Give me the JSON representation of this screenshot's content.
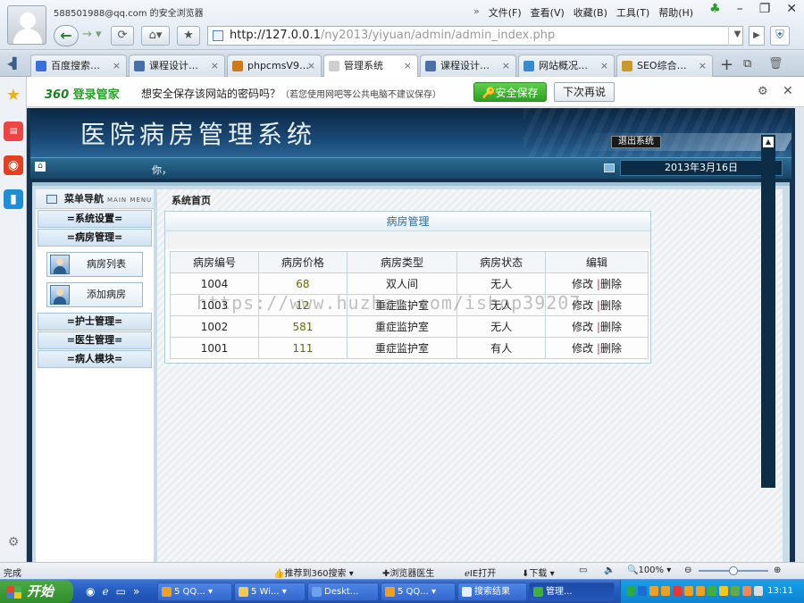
{
  "browser": {
    "account": "588501988@qq.com 的安全浏览器",
    "menu": [
      "文件(F)",
      "查看(V)",
      "收藏(B)",
      "工具(T)",
      "帮助(H)"
    ],
    "url_host": "http://127.0.0.1",
    "url_path": "/ny2013/yiyuan/admin/admin_index.php",
    "tabs": [
      {
        "label": "百度搜索…",
        "color": "#3a6ee0"
      },
      {
        "label": "课程设计…",
        "color": "#4a6fa8"
      },
      {
        "label": "phpcmsV9…",
        "color": "#cc7a1a"
      },
      {
        "label": "管理系统",
        "color": "#cfcfcf"
      },
      {
        "label": "课程设计…",
        "color": "#4a6fa8"
      },
      {
        "label": "网站概况…",
        "color": "#3a8ad0"
      },
      {
        "label": "SEO综合…",
        "color": "#c99a2a"
      }
    ]
  },
  "password_bar": {
    "logo_brand": "360",
    "logo_text": "登录管家",
    "message": "想安全保存该网站的密码吗？",
    "hint": "（若您使用网吧等公共电脑不建议保存）",
    "save_label": "安全保存",
    "later_label": "下次再说"
  },
  "app": {
    "title": "医院病房管理系统",
    "logout_label": "退出系统",
    "greeting": "你，",
    "date": "2013年3月16日",
    "watermark": "https://www.huzhan.com/ishop39207"
  },
  "sidebar": {
    "title": "菜单导航",
    "title_en": "MAIN MENU",
    "groups": [
      {
        "label": "=系统设置="
      },
      {
        "label": "=病房管理="
      },
      {
        "label": "=护士管理="
      },
      {
        "label": "=医生管理="
      },
      {
        "label": "=病人模块="
      }
    ],
    "items": [
      {
        "label": "病房列表"
      },
      {
        "label": "添加病房"
      }
    ]
  },
  "main": {
    "breadcrumb": "系统首页",
    "panel_title": "病房管理",
    "columns": [
      "病房编号",
      "病房价格",
      "病房类型",
      "病房状态",
      "编辑"
    ],
    "rows": [
      {
        "id": "1004",
        "price": "68",
        "type": "双人间",
        "status": "无人"
      },
      {
        "id": "1003",
        "price": "12",
        "type": "重症监护室",
        "status": "无人"
      },
      {
        "id": "1002",
        "price": "581",
        "type": "重症监护室",
        "status": "无人"
      },
      {
        "id": "1001",
        "price": "111",
        "type": "重症监护室",
        "status": "有人"
      }
    ],
    "edit_label": "修改",
    "delete_label": "删除"
  },
  "statusbar": {
    "done": "完成",
    "recommend": "推荐到360搜索",
    "doctor": "浏览器医生",
    "ie_open": "IE打开",
    "download": "下载",
    "zoom": "100%"
  },
  "taskbar": {
    "start_label": "开始",
    "buttons": [
      {
        "label": "5 QQ...",
        "color": "#f0a020"
      },
      {
        "label": "5 Wi...",
        "color": "#f4c84a"
      },
      {
        "label": "Deskt...",
        "color": "#6fa0e8"
      },
      {
        "label": "5 QQ...",
        "color": "#f0a020"
      },
      {
        "label": "搜索结果",
        "color": "#e8eef8"
      },
      {
        "label": "管理...",
        "color": "#3fb13a"
      }
    ],
    "clock": "13:11"
  }
}
